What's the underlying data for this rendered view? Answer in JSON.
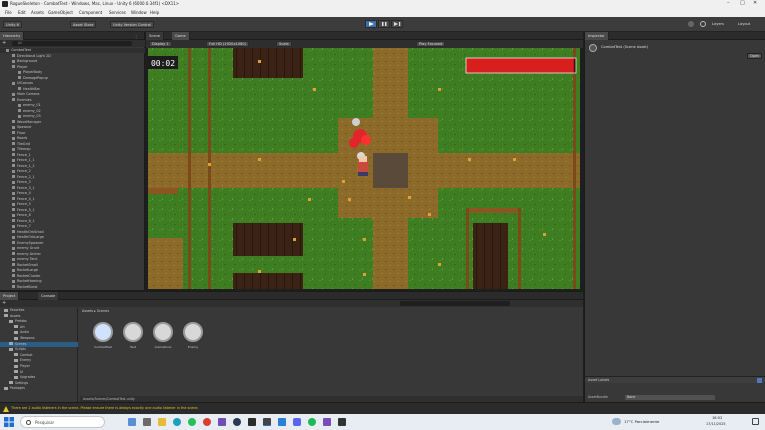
{
  "window": {
    "title": "RogueSkeleton - CombatTest - Windows, Mac, Linux - Unity 6 (6000.0.34f1) <DX11>"
  },
  "menu": [
    "File",
    "Edit",
    "Assets",
    "GameObject",
    "Component",
    "Services",
    "Window",
    "Help"
  ],
  "toolbar": {
    "account": "Unity 6",
    "cloud": "Asset Store",
    "version_control": "Unity Version Control",
    "layers": "Layers",
    "layout": "Layout"
  },
  "hierarchy": {
    "tab": "Hierarchy",
    "search_placeholder": "All",
    "items": [
      {
        "label": "CombatTest",
        "indent": 0
      },
      {
        "label": "Directional Light 2D",
        "indent": 1
      },
      {
        "label": "Background",
        "indent": 1
      },
      {
        "label": "Player",
        "indent": 1
      },
      {
        "label": "PlayerBody",
        "indent": 2
      },
      {
        "label": "DamagePopup",
        "indent": 2
      },
      {
        "label": "UICanvas",
        "indent": 1
      },
      {
        "label": "HealthBar",
        "indent": 2
      },
      {
        "label": "Main Camera",
        "indent": 1
      },
      {
        "label": "Enemies",
        "indent": 1
      },
      {
        "label": "enemy_01",
        "indent": 2
      },
      {
        "label": "enemy_02",
        "indent": 2
      },
      {
        "label": "enemy_03",
        "indent": 2
      },
      {
        "label": "WaveManager",
        "indent": 1
      },
      {
        "label": "Spawner",
        "indent": 1
      },
      {
        "label": "Floor",
        "indent": 1
      },
      {
        "label": "Roads",
        "indent": 1
      },
      {
        "label": "TileGrid",
        "indent": 1
      },
      {
        "label": "Tilemap",
        "indent": 1
      },
      {
        "label": "Fence_1",
        "indent": 1
      },
      {
        "label": "Fence_1_1",
        "indent": 1
      },
      {
        "label": "Fence_1_2",
        "indent": 1
      },
      {
        "label": "Fence_2",
        "indent": 1
      },
      {
        "label": "Fence_2_1",
        "indent": 1
      },
      {
        "label": "Fence_3",
        "indent": 1
      },
      {
        "label": "Fence_3_1",
        "indent": 1
      },
      {
        "label": "Fence_4",
        "indent": 1
      },
      {
        "label": "Fence_4_1",
        "indent": 1
      },
      {
        "label": "Fence_5",
        "indent": 1
      },
      {
        "label": "Fence_5_1",
        "indent": 1
      },
      {
        "label": "Fence_6",
        "indent": 1
      },
      {
        "label": "Fence_6_1",
        "indent": 1
      },
      {
        "label": "Fence_7",
        "indent": 1
      },
      {
        "label": "HealthOrbSmall",
        "indent": 1
      },
      {
        "label": "HealthOrbLarge",
        "indent": 1
      },
      {
        "label": "EnemySpawner",
        "indent": 1
      },
      {
        "label": "enemy Grunt",
        "indent": 1
      },
      {
        "label": "enemy Archer",
        "indent": 1
      },
      {
        "label": "enemy Tank",
        "indent": 1
      },
      {
        "label": "RocketSmall",
        "indent": 1
      },
      {
        "label": "RocketLarge",
        "indent": 1
      },
      {
        "label": "RocketCluster",
        "indent": 1
      },
      {
        "label": "RocketHoming",
        "indent": 1
      },
      {
        "label": "RocketBurst",
        "indent": 1
      }
    ]
  },
  "gameview": {
    "tabs": [
      "Scene",
      "Game"
    ],
    "display": "Display 1",
    "resolution": "Full HD (1920x1080)",
    "scale": "Scale",
    "play_focused": "Play Focused",
    "timer": "00:02",
    "health_fraction": 0.98
  },
  "inspector": {
    "tab": "Inspector",
    "object": "CombatTest (Scene Asset)",
    "open_button": "Open",
    "asset_labels": "Asset Labels",
    "asset_bundle": "AssetBundle",
    "bundle_value": "None"
  },
  "project": {
    "tabs": [
      "Project",
      "Console"
    ],
    "breadcrumb": [
      "Assets",
      "Scenes"
    ],
    "tree": [
      {
        "label": "Favorites",
        "indent": 0
      },
      {
        "label": "Assets",
        "indent": 0
      },
      {
        "label": "Prefabs",
        "indent": 1
      },
      {
        "label": "Art",
        "indent": 2
      },
      {
        "label": "Audio",
        "indent": 2
      },
      {
        "label": "Weapons",
        "indent": 2
      },
      {
        "label": "Scenes",
        "indent": 1
      },
      {
        "label": "Scripts",
        "indent": 1
      },
      {
        "label": "Combat",
        "indent": 2
      },
      {
        "label": "Enemy",
        "indent": 2
      },
      {
        "label": "Player",
        "indent": 2
      },
      {
        "label": "UI",
        "indent": 2
      },
      {
        "label": "Upgrades",
        "indent": 2
      },
      {
        "label": "Settings",
        "indent": 1
      },
      {
        "label": "Packages",
        "indent": 0
      }
    ],
    "files": [
      "CombatTest",
      "Test",
      "Animations",
      "Enemy"
    ],
    "path": "Assets/Scenes/CombatTest.unity"
  },
  "status": {
    "message": "There are 2 audio listeners in the scene. Please ensure there is always exactly one audio listener in the scene."
  },
  "taskbar": {
    "search": "Pesquisar",
    "weather": "17°C  Parcialmente",
    "time": "18:52",
    "date": "17/11/2025"
  },
  "colors": {
    "grass": "#3f7d22",
    "dirt": "#8c6a2a",
    "healthbar": "#d91e1e"
  }
}
